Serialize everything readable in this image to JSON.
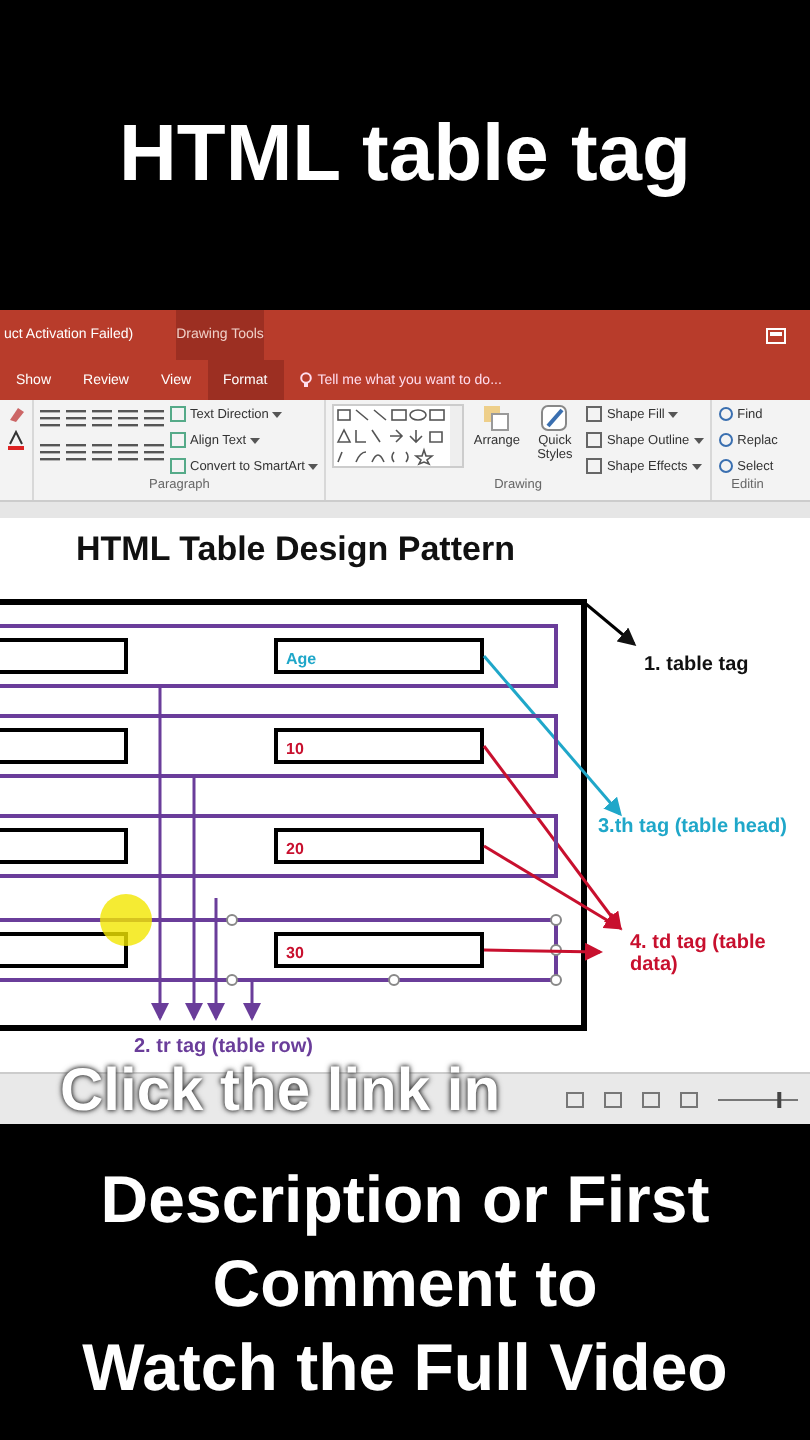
{
  "video_title": "HTML table tag",
  "ribbon": {
    "window_title": "uct Activation Failed)",
    "context_tab": "Drawing Tools",
    "tabs": [
      {
        "label": "Show",
        "selected": false
      },
      {
        "label": "Review",
        "selected": false
      },
      {
        "label": "View",
        "selected": false
      },
      {
        "label": "Format",
        "selected": true
      }
    ],
    "tell_me": "Tell me what you want to do...",
    "paragraph": {
      "commands": [
        "Text Direction",
        "Align Text",
        "Convert to SmartArt"
      ],
      "label": "Paragraph"
    },
    "drawing": {
      "arrange": "Arrange",
      "quick_styles": "Quick Styles",
      "commands": [
        "Shape Fill",
        "Shape Outline",
        "Shape Effects"
      ],
      "label": "Drawing"
    },
    "editing": {
      "commands": [
        "Find",
        "Replac",
        "Select"
      ],
      "label": "Editin"
    }
  },
  "slide": {
    "title": "HTML Table Design Pattern",
    "rows": [
      {
        "kind": "head",
        "cell": "Age",
        "selected": false
      },
      {
        "kind": "data",
        "cell": "10",
        "selected": false
      },
      {
        "kind": "data",
        "cell": "20",
        "selected": false
      },
      {
        "kind": "data",
        "cell": "30",
        "selected": true
      }
    ],
    "labels": [
      {
        "kind": "table",
        "text": "1. table tag"
      },
      {
        "kind": "row",
        "text": "2. tr tag (table row)"
      },
      {
        "kind": "head",
        "text": "3.th tag (table head)"
      },
      {
        "kind": "data",
        "text": "4. td tag (table data)"
      }
    ]
  },
  "status_bar": {
    "zoom": {
      "level": 0.78
    }
  },
  "caption": {
    "overlay": "Click the link in",
    "lines": [
      "Description or First",
      "Comment to",
      "Watch the Full Video"
    ]
  }
}
